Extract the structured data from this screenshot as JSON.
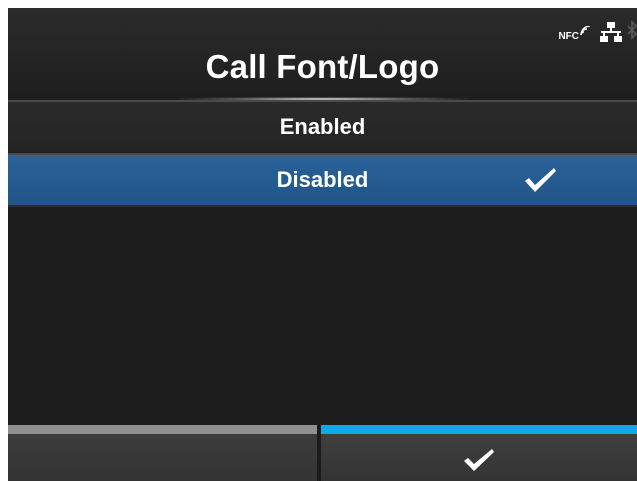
{
  "header": {
    "title": "Call Font/Logo",
    "status": {
      "nfc_label": "NFC",
      "icons": [
        "nfc-icon",
        "network-icon",
        "bluetooth-icon"
      ]
    }
  },
  "options": [
    {
      "label": "Enabled",
      "selected": false
    },
    {
      "label": "Disabled",
      "selected": true
    }
  ],
  "footer": {
    "left_button": {
      "label": ""
    },
    "right_button": {
      "icon": "check-icon"
    }
  },
  "colors": {
    "background": "#1d1d1d",
    "selected": "#245c92",
    "accent": "#0ea9e6",
    "left_bar": "#8f8f8f"
  }
}
